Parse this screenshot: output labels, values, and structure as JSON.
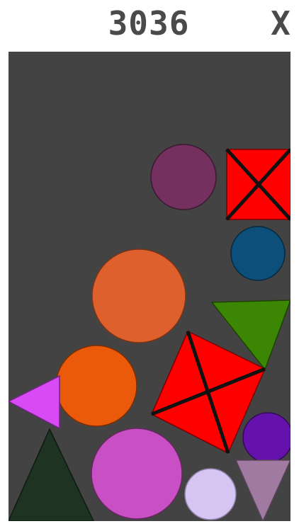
{
  "header": {
    "score": "3036",
    "close_label": "X"
  },
  "game": {
    "board_color": "#434343",
    "pieces": [
      {
        "name": "purple-circle-top",
        "shape": "circle",
        "color": "#74305f"
      },
      {
        "name": "red-square-crossed-top",
        "shape": "square-x",
        "color": "#fe0000"
      },
      {
        "name": "blue-circle",
        "shape": "circle",
        "color": "#0b4f7a"
      },
      {
        "name": "orange-circle-large",
        "shape": "circle",
        "color": "#de612d"
      },
      {
        "name": "green-triangle",
        "shape": "triangle",
        "color": "#3b8703"
      },
      {
        "name": "red-square-crossed-rotated",
        "shape": "square-x",
        "color": "#fe0000"
      },
      {
        "name": "orange-circle",
        "shape": "circle",
        "color": "#ea5a0a"
      },
      {
        "name": "magenta-triangle",
        "shape": "triangle",
        "color": "#d84af4"
      },
      {
        "name": "violet-circle",
        "shape": "circle",
        "color": "#6512ac"
      },
      {
        "name": "dark-green-triangle",
        "shape": "triangle",
        "color": "#1e3322"
      },
      {
        "name": "pink-circle",
        "shape": "circle",
        "color": "#c94fc4"
      },
      {
        "name": "lavender-circle",
        "shape": "circle",
        "color": "#d6c5f2"
      },
      {
        "name": "mauve-triangle",
        "shape": "triangle",
        "color": "#a07aa1"
      }
    ]
  }
}
